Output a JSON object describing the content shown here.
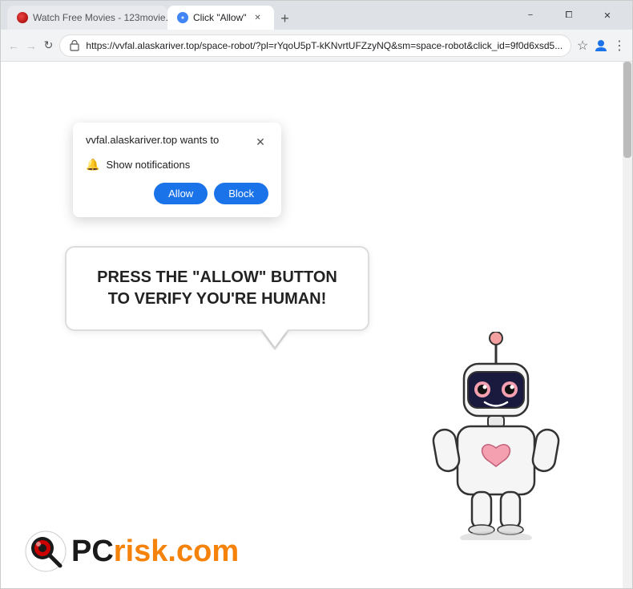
{
  "window": {
    "title": "Click \"Allow\""
  },
  "tabs": [
    {
      "label": "Watch Free Movies - 123movie...",
      "active": false,
      "favicon": "movie-favicon"
    },
    {
      "label": "Click \"Allow\"",
      "active": true,
      "favicon": "shield-favicon"
    }
  ],
  "title_bar": {
    "new_tab_label": "+",
    "minimize_label": "−",
    "restore_label": "⧠",
    "close_label": "✕"
  },
  "address_bar": {
    "url": "https://vvfal.alaskariver.top/space-robot/?pl=rYqoU5pT-kKNvrtUFZzyNQ&sm=space-robot&click_id=9f0d6xsd5...",
    "back_icon": "←",
    "forward_icon": "→",
    "reload_icon": "↻",
    "bookmark_icon": "☆",
    "profile_icon": "👤",
    "menu_icon": "⋮"
  },
  "notification_popup": {
    "title": "vvfal.alaskariver.top wants to",
    "close_icon": "✕",
    "permission_text": "Show notifications",
    "allow_label": "Allow",
    "block_label": "Block"
  },
  "main_content": {
    "speech_text": "PRESS THE \"ALLOW\" BUTTON TO VERIFY YOU'RE HUMAN!"
  },
  "pcrisk": {
    "pc_text": "PC",
    "risk_text": "risk.com"
  }
}
